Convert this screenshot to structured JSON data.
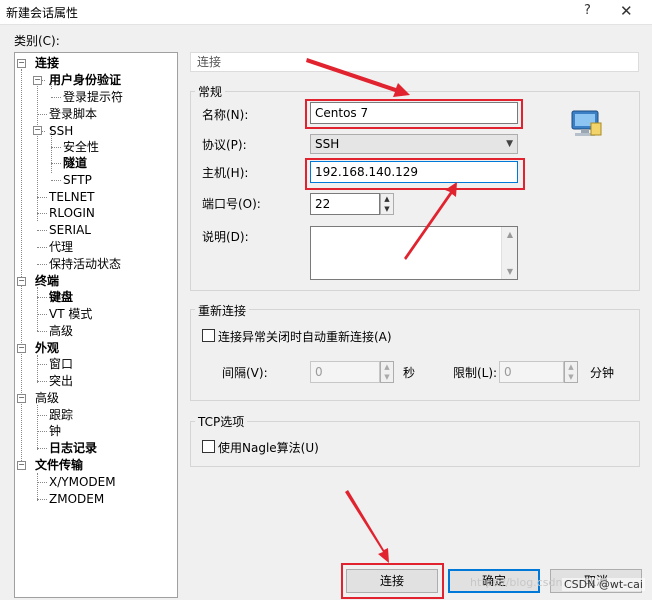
{
  "window": {
    "title": "新建会话属性",
    "help_label": "?",
    "close_label": "✕"
  },
  "category": {
    "label": "类别(C):",
    "tree": [
      {
        "label": "连接",
        "bold": true
      },
      {
        "label": "用户身份验证",
        "bold": true
      },
      {
        "label": "登录提示符"
      },
      {
        "label": "登录脚本"
      },
      {
        "label": "SSH"
      },
      {
        "label": "安全性"
      },
      {
        "label": "隧道",
        "bold": true
      },
      {
        "label": "SFTP"
      },
      {
        "label": "TELNET"
      },
      {
        "label": "RLOGIN"
      },
      {
        "label": "SERIAL"
      },
      {
        "label": "代理"
      },
      {
        "label": "保持活动状态"
      },
      {
        "label": "终端",
        "bold": true
      },
      {
        "label": "键盘",
        "bold": true
      },
      {
        "label": "VT 模式"
      },
      {
        "label": "高级"
      },
      {
        "label": "外观",
        "bold": true
      },
      {
        "label": "窗口"
      },
      {
        "label": "突出"
      },
      {
        "label": "高级"
      },
      {
        "label": "跟踪"
      },
      {
        "label": "钟"
      },
      {
        "label": "日志记录",
        "bold": true
      },
      {
        "label": "文件传输",
        "bold": true
      },
      {
        "label": "X/YMODEM"
      },
      {
        "label": "ZMODEM"
      }
    ]
  },
  "panel": {
    "header": "连接",
    "general": {
      "title": "常规",
      "name_label": "名称(N):",
      "name_value": "Centos 7",
      "protocol_label": "协议(P):",
      "protocol_value": "SSH",
      "host_label": "主机(H):",
      "host_value": "192.168.140.129",
      "port_label": "端口号(O):",
      "port_value": "22",
      "desc_label": "说明(D):",
      "desc_value": ""
    },
    "reconnect": {
      "title": "重新连接",
      "auto_reconnect_label": "连接异常关闭时自动重新连接(A)",
      "interval_label": "间隔(V):",
      "interval_value": "0",
      "interval_unit": "秒",
      "limit_label": "限制(L):",
      "limit_value": "0",
      "limit_unit": "分钟"
    },
    "tcp": {
      "title": "TCP选项",
      "nagle_label": "使用Nagle算法(U)"
    }
  },
  "buttons": {
    "connect": "连接",
    "ok": "确定",
    "cancel": "取消"
  },
  "watermark": "https://blog.csdn.net/",
  "csdn_badge": "CSDN @wt-cai",
  "colors": {
    "highlight_red": "#e0232f",
    "default_button_blue": "#0078d7"
  }
}
